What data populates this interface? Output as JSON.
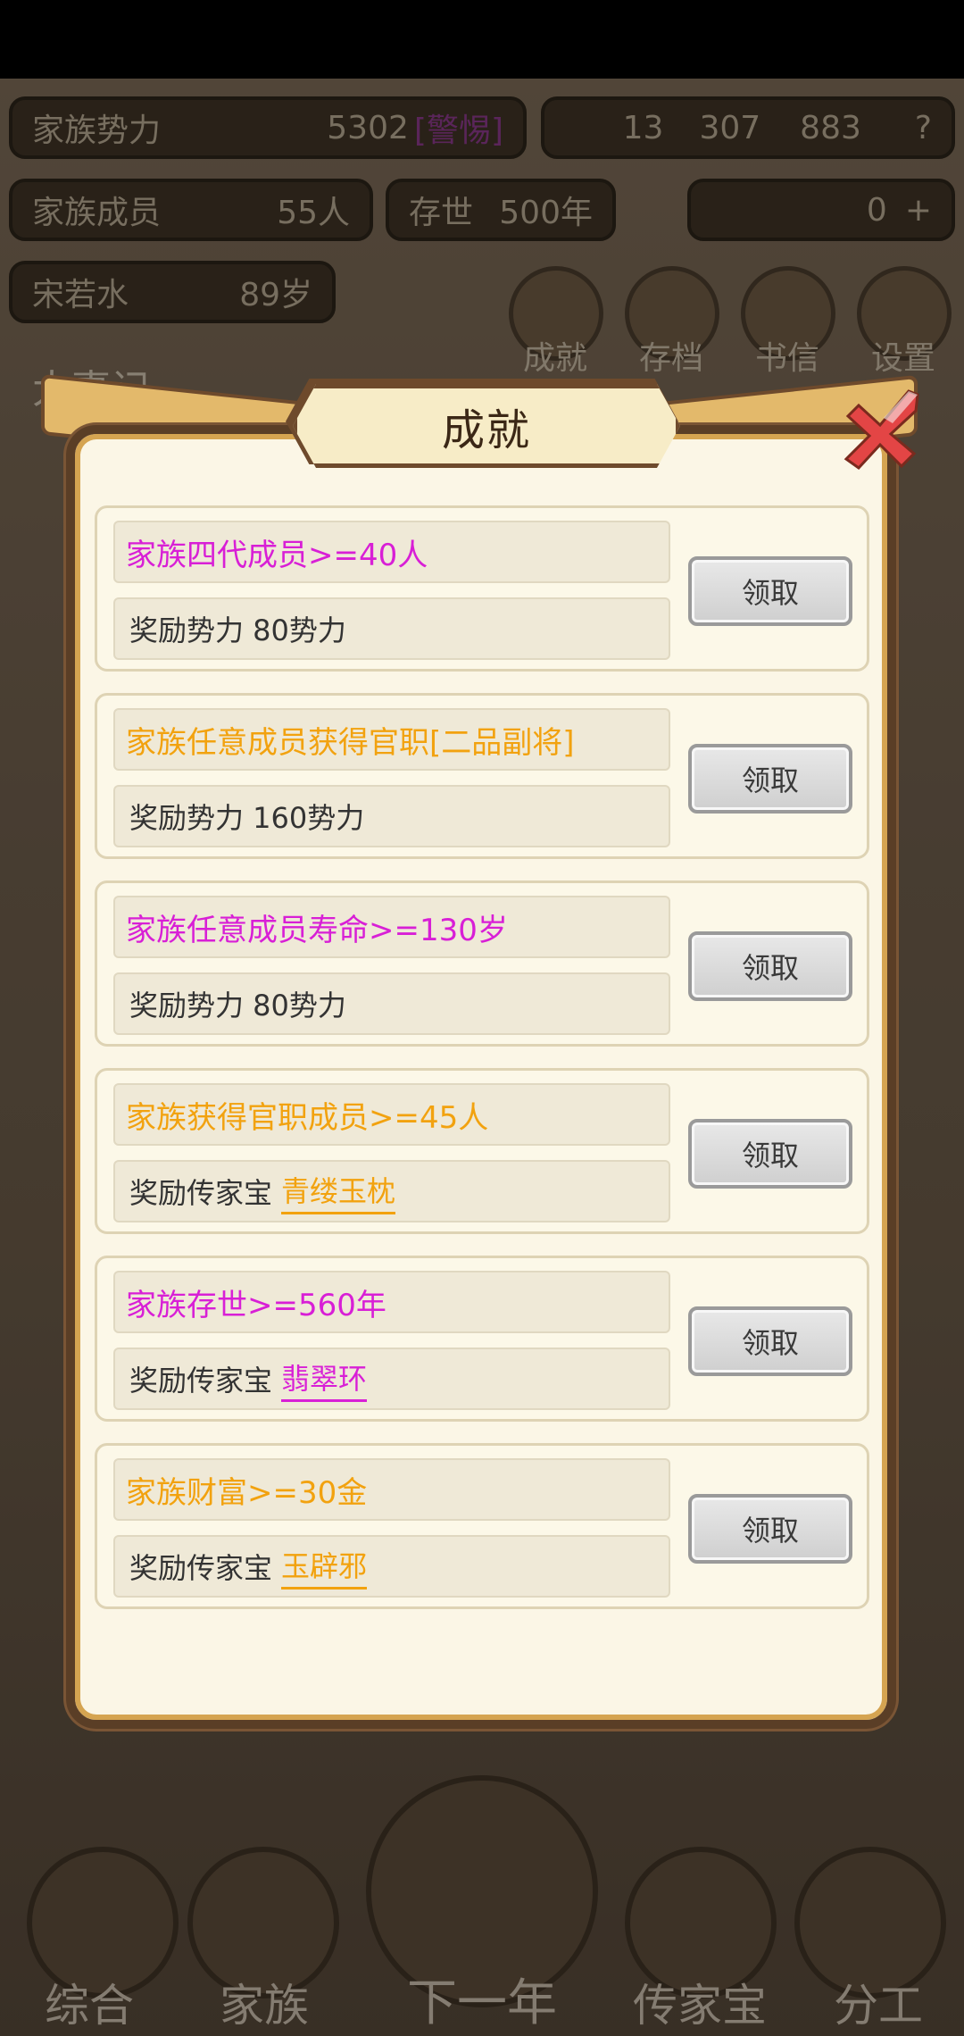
{
  "header": {
    "power_label": "家族势力",
    "power_value": "5302",
    "power_rank": "[警惕]",
    "currency_1": "13",
    "currency_2": "307",
    "currency_3": "883",
    "members_label": "家族成员",
    "members_value": "55人",
    "exist_label": "存世",
    "exist_value": "500年",
    "gold_value": "0",
    "leader_name": "宋若水",
    "leader_age": "89岁"
  },
  "top_buttons": [
    {
      "label": "成就",
      "icon": "achievement-icon"
    },
    {
      "label": "存档",
      "icon": "save-icon"
    },
    {
      "label": "书信",
      "icon": "letter-icon"
    },
    {
      "label": "设置",
      "icon": "settings-icon"
    }
  ],
  "background_log": {
    "title": "大事记"
  },
  "bottom_nav": [
    {
      "label": "综合"
    },
    {
      "label": "家族"
    },
    {
      "label": "下一年"
    },
    {
      "label": "传家宝"
    },
    {
      "label": "分工"
    }
  ],
  "dialog": {
    "title": "成就",
    "claim_label": "领取",
    "achievements": [
      {
        "condition": "家族四代成员>=40人",
        "color": "#d81fd6",
        "reward_prefix": "奖励势力 80势力",
        "reward_item": "",
        "item_color": ""
      },
      {
        "condition": "家族任意成员获得官职[二品副将]",
        "color": "#f2a20f",
        "reward_prefix": "奖励势力 160势力",
        "reward_item": "",
        "item_color": ""
      },
      {
        "condition": "家族任意成员寿命>=130岁",
        "color": "#d81fd6",
        "reward_prefix": "奖励势力 80势力",
        "reward_item": "",
        "item_color": ""
      },
      {
        "condition": "家族获得官职成员>=45人",
        "color": "#f2a20f",
        "reward_prefix": "奖励传家宝",
        "reward_item": "青缕玉枕",
        "item_color": "#f2a20f"
      },
      {
        "condition": "家族存世>=560年",
        "color": "#d81fd6",
        "reward_prefix": "奖励传家宝",
        "reward_item": "翡翠环",
        "item_color": "#d81fd6"
      },
      {
        "condition": "家族财富>=30金",
        "color": "#f2a20f",
        "reward_prefix": "奖励传家宝",
        "reward_item": "玉辟邪",
        "item_color": "#f2a20f"
      }
    ]
  }
}
